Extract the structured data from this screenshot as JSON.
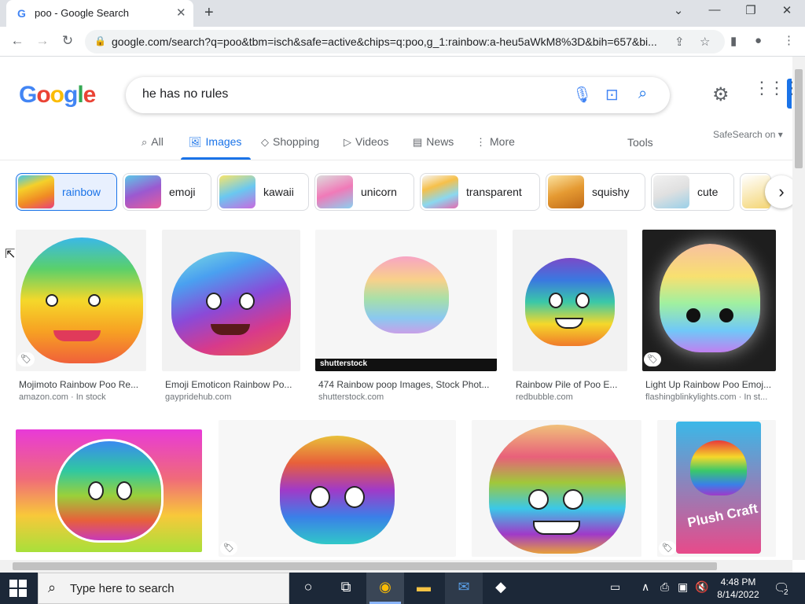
{
  "browser": {
    "tab_title": "poo - Google Search",
    "tab_favicon": "G",
    "url": "google.com/search?q=poo&tbm=isch&safe=active&chips=q:poo,g_1:rainbow:a-heu5aWkM8%3D&bih=657&bi..."
  },
  "search": {
    "query": "he has no rules",
    "logo": "Google"
  },
  "nav_tabs": [
    {
      "label": "All",
      "icon": "search-icon"
    },
    {
      "label": "Images",
      "icon": "image-icon"
    },
    {
      "label": "Shopping",
      "icon": "tag-icon"
    },
    {
      "label": "Videos",
      "icon": "play-icon"
    },
    {
      "label": "News",
      "icon": "news-icon"
    },
    {
      "label": "More",
      "icon": "more-icon"
    }
  ],
  "tools_label": "Tools",
  "safesearch_label": "SafeSearch on",
  "chips": [
    {
      "label": "rainbow",
      "selected": true
    },
    {
      "label": "emoji"
    },
    {
      "label": "kawaii"
    },
    {
      "label": "unicorn"
    },
    {
      "label": "transparent"
    },
    {
      "label": "squishy"
    },
    {
      "label": "cute"
    }
  ],
  "results_row1": [
    {
      "caption": "Mojimoto Rainbow Poo Re...",
      "source": "amazon.com · In stock"
    },
    {
      "caption": "Emoji Emoticon Rainbow Po...",
      "source": "gaypridehub.com"
    },
    {
      "caption": "474 Rainbow poop Images, Stock Phot...",
      "source": "shutterstock.com",
      "watermark": "shutterstock"
    },
    {
      "caption": "Rainbow Pile of Poo E...",
      "source": "redbubble.com"
    },
    {
      "caption": "Light Up Rainbow Poo Emoj...",
      "source": "flashingblinkylights.com · In st..."
    }
  ],
  "results_row2_image_text": "Plush Craft",
  "taskbar": {
    "search_placeholder": "Type here to search",
    "time": "4:48 PM",
    "date": "8/14/2022",
    "notification_count": "2"
  }
}
